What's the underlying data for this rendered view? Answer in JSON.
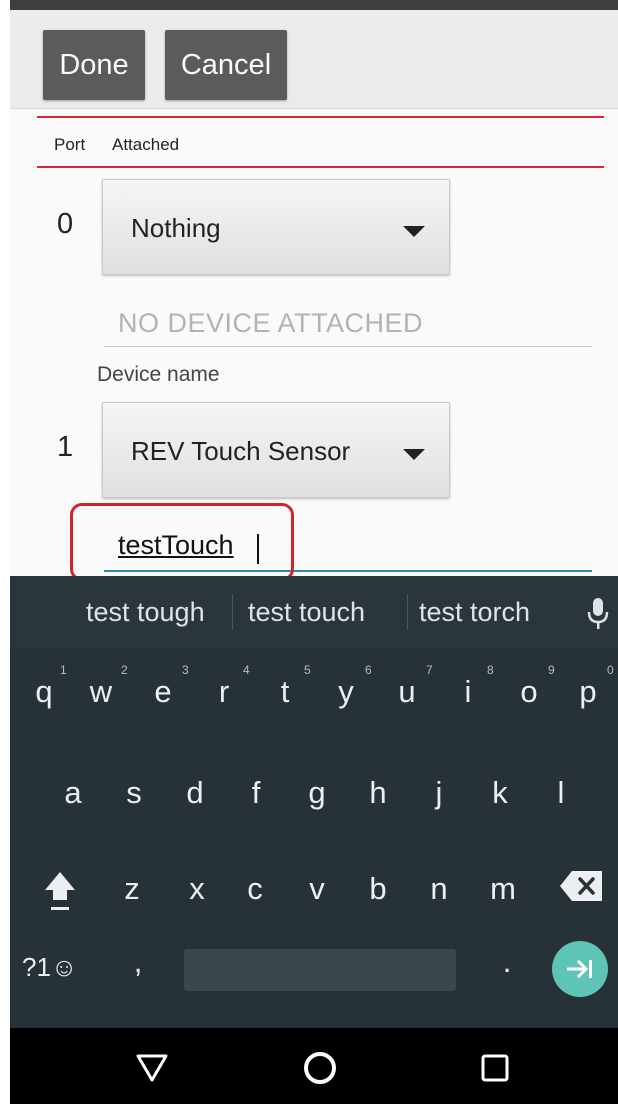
{
  "actionbar": {
    "done_label": "Done",
    "cancel_label": "Cancel"
  },
  "table_header": {
    "port": "Port",
    "attached": "Attached"
  },
  "ports": [
    {
      "number": "0",
      "device": "Nothing",
      "field_hint": "NO DEVICE ATTACHED",
      "name_label": "Device name"
    },
    {
      "number": "1",
      "device": "REV Touch Sensor",
      "name_value": "testTouch"
    }
  ],
  "keyboard": {
    "suggestions": [
      "test tough",
      "test touch",
      "test torch"
    ],
    "row1": [
      "q",
      "w",
      "e",
      "r",
      "t",
      "y",
      "u",
      "i",
      "o",
      "p"
    ],
    "row1_numbers": [
      "1",
      "2",
      "3",
      "4",
      "5",
      "6",
      "7",
      "8",
      "9",
      "0"
    ],
    "row2": [
      "a",
      "s",
      "d",
      "f",
      "g",
      "h",
      "j",
      "k",
      "l"
    ],
    "row3": [
      "z",
      "x",
      "c",
      "v",
      "b",
      "n",
      "m"
    ],
    "symbols_label": "?1☺",
    "comma": ",",
    "period": "."
  },
  "icons": [
    "mic-icon",
    "shift-icon",
    "backspace-icon",
    "enter-icon",
    "back-icon",
    "home-icon",
    "recents-icon"
  ],
  "colors": {
    "accent_red": "#d9252f",
    "teal": "#5ec4b6",
    "keyboard_bg": "#263238"
  }
}
